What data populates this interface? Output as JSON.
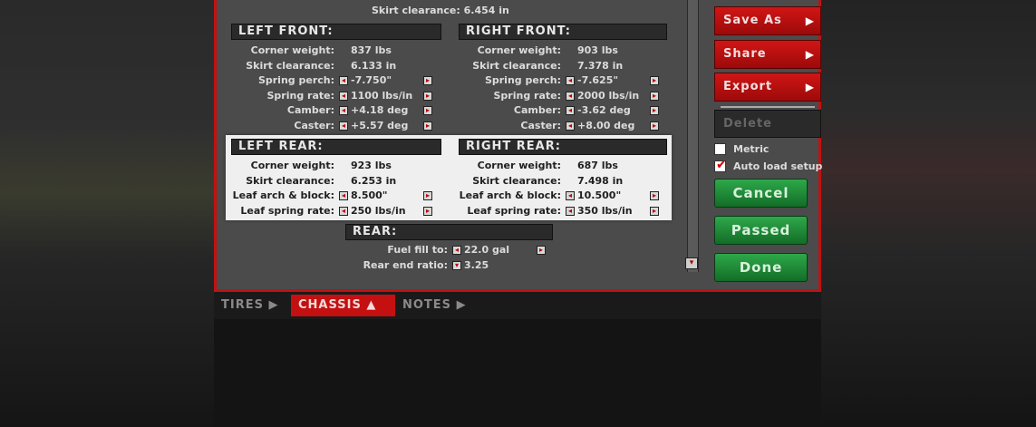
{
  "top": {
    "clearance_label": "Skirt clearance:",
    "clearance_value": "6.454 in"
  },
  "left_front": {
    "title": "LEFT FRONT:",
    "rows": [
      {
        "label": "Corner weight:",
        "value": "837 lbs",
        "adjustable": false
      },
      {
        "label": "Skirt clearance:",
        "value": "6.133 in",
        "adjustable": false
      },
      {
        "label": "Spring perch:",
        "value": "-7.750\"",
        "adjustable": true
      },
      {
        "label": "Spring rate:",
        "value": "1100 lbs/in",
        "adjustable": true
      },
      {
        "label": "Camber:",
        "value": "+4.18 deg",
        "adjustable": true
      },
      {
        "label": "Caster:",
        "value": "+5.57 deg",
        "adjustable": true
      }
    ]
  },
  "right_front": {
    "title": "RIGHT FRONT:",
    "rows": [
      {
        "label": "Corner weight:",
        "value": "903 lbs",
        "adjustable": false
      },
      {
        "label": "Skirt clearance:",
        "value": "7.378 in",
        "adjustable": false
      },
      {
        "label": "Spring perch:",
        "value": "-7.625\"",
        "adjustable": true
      },
      {
        "label": "Spring rate:",
        "value": "2000 lbs/in",
        "adjustable": true
      },
      {
        "label": "Camber:",
        "value": "-3.62 deg",
        "adjustable": true
      },
      {
        "label": "Caster:",
        "value": "+8.00 deg",
        "adjustable": true
      }
    ]
  },
  "left_rear": {
    "title": "LEFT REAR:",
    "rows": [
      {
        "label": "Corner weight:",
        "value": "923 lbs",
        "adjustable": false
      },
      {
        "label": "Skirt clearance:",
        "value": "6.253 in",
        "adjustable": false
      },
      {
        "label": "Leaf arch & block:",
        "value": "8.500\"",
        "adjustable": true
      },
      {
        "label": "Leaf spring rate:",
        "value": "250 lbs/in",
        "adjustable": true
      }
    ]
  },
  "right_rear": {
    "title": "RIGHT REAR:",
    "rows": [
      {
        "label": "Corner weight:",
        "value": "687 lbs",
        "adjustable": false
      },
      {
        "label": "Skirt clearance:",
        "value": "7.498 in",
        "adjustable": false
      },
      {
        "label": "Leaf arch & block:",
        "value": "10.500\"",
        "adjustable": true
      },
      {
        "label": "Leaf spring rate:",
        "value": "350 lbs/in",
        "adjustable": true
      }
    ]
  },
  "rear": {
    "title": "REAR:",
    "fuel_label": "Fuel fill to:",
    "fuel_value": "22.0 gal",
    "ratio_label": "Rear end ratio:",
    "ratio_value": "3.25"
  },
  "side": {
    "save_as": "Save As",
    "share": "Share",
    "export": "Export",
    "delete": "Delete",
    "metric_label": "Metric",
    "metric_checked": false,
    "autoload_label": "Auto load setup",
    "autoload_checked": true,
    "cancel": "Cancel",
    "passed": "Passed",
    "done": "Done"
  },
  "tabs": [
    {
      "label": "TIRES",
      "glyph": "▶",
      "active": false
    },
    {
      "label": "CHASSIS",
      "glyph": "▲",
      "active": true
    },
    {
      "label": "NOTES",
      "glyph": "▶",
      "active": false
    }
  ],
  "glyphs": {
    "left": "◂",
    "right": "▸",
    "down": "▾"
  },
  "colors": {
    "accent_red": "#c41010",
    "green": "#1f8a37",
    "panel": "#4b4b4b"
  }
}
